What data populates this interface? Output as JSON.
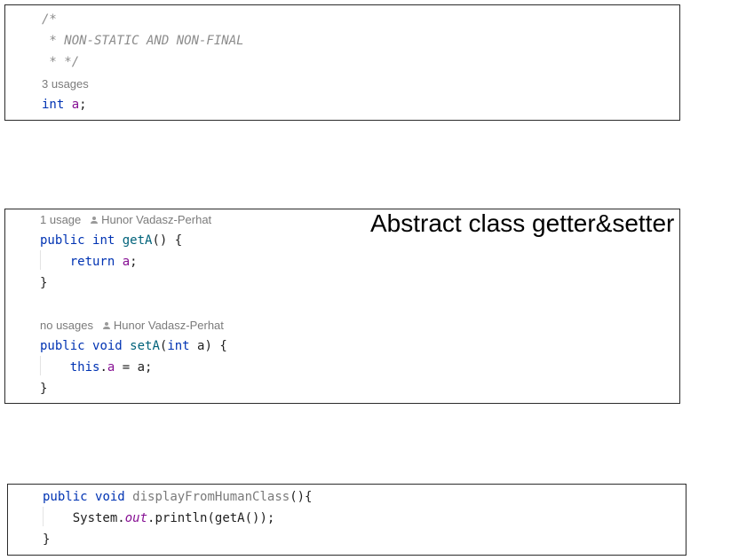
{
  "panel1": {
    "comment_open": "/*",
    "comment_body": " * NON-STATIC AND NON-FINAL",
    "comment_close": " * */",
    "usages": "3 usages",
    "decl_type": "int",
    "decl_name": "a",
    "decl_semicolon": ";"
  },
  "panel2": {
    "title": "Abstract class getter&setter",
    "getter": {
      "usages": "1 usage",
      "author": "Hunor Vadasz-Perhat",
      "kw_public": "public",
      "kw_type": "int",
      "method_name": "getA",
      "signature_rest": "() {",
      "kw_return": "return",
      "return_field": "a",
      "return_semicolon": ";",
      "close_brace": "}"
    },
    "setter": {
      "usages": "no usages",
      "author": "Hunor Vadasz-Perhat",
      "kw_public": "public",
      "kw_type": "void",
      "method_name": "setA",
      "param_open": "(",
      "param_type": "int",
      "param_rest": " a) {",
      "kw_this": "this",
      "dot": ".",
      "field": "a",
      "assign_rest": " = a;",
      "close_brace": "}"
    }
  },
  "panel3": {
    "kw_public": "public",
    "kw_type": "void",
    "method_name": "displayFromHumanClass",
    "signature_rest": "(){",
    "call_prefix": "System.",
    "call_static": "out",
    "call_rest": ".println(getA());",
    "close_brace": "}"
  },
  "colors": {
    "keyword": "#0033b3",
    "field": "#871094",
    "comment": "#8c8c8c",
    "method_declaration": "#00627a",
    "hint": "#7b7b7b"
  }
}
